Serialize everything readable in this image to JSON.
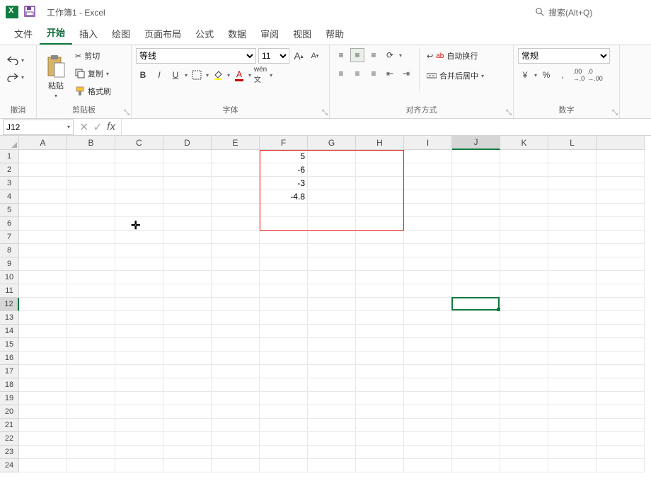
{
  "title": {
    "doc": "工作簿1",
    "sep": " - ",
    "app": "Excel"
  },
  "search": {
    "placeholder": "搜索(Alt+Q)"
  },
  "tabs": [
    "文件",
    "开始",
    "插入",
    "绘图",
    "页面布局",
    "公式",
    "数据",
    "审阅",
    "视图",
    "帮助"
  ],
  "active_tab": 1,
  "ribbon": {
    "undo_label": "撤消",
    "clipboard": {
      "paste": "粘贴",
      "cut": "剪切",
      "copy": "复制",
      "painter": "格式刷",
      "label": "剪贴板"
    },
    "font": {
      "name": "等线",
      "size": "11",
      "label": "字体"
    },
    "align": {
      "wrap": "自动换行",
      "merge": "合并后居中",
      "label": "对齐方式"
    },
    "number": {
      "format": "常规",
      "label": "数字"
    }
  },
  "namebox": "J12",
  "columns": [
    "A",
    "B",
    "C",
    "D",
    "E",
    "F",
    "G",
    "H",
    "I",
    "J",
    "K",
    "L",
    ""
  ],
  "rows_count": 24,
  "selected_col": "J",
  "selected_row": 12,
  "cell_data": {
    "F1": "5",
    "F2": "-6",
    "F3": "-3",
    "F4": "-4.8"
  },
  "red_box": {
    "col_start": "F",
    "col_end": "H",
    "row_start": 1,
    "row_end": 5
  },
  "cursor": {
    "glyph": "✛"
  }
}
